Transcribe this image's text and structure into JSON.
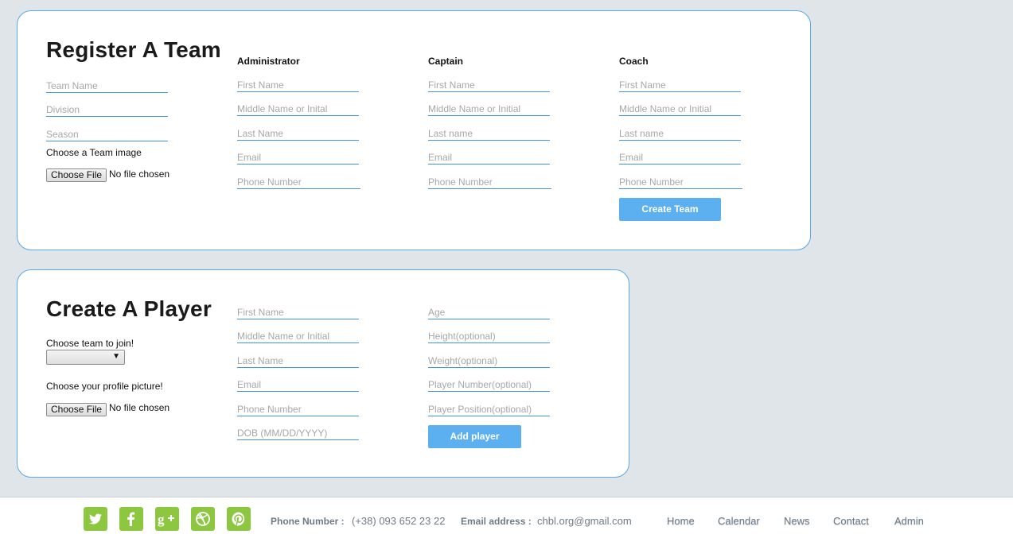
{
  "team_form": {
    "title": "Register A Team",
    "team_name_placeholder": "Team Name",
    "division_placeholder": "Division",
    "season_placeholder": "Season",
    "image_label": "Choose a Team image",
    "file_button": "Choose File",
    "file_status": "No file chosen",
    "administrator": {
      "heading": "Administrator",
      "first_name": "First Name",
      "middle_name": "Middle Name or Inital",
      "last_name": "Last Name",
      "email": "Email",
      "phone": "Phone Number"
    },
    "captain": {
      "heading": "Captain",
      "first_name": "First Name",
      "middle_name": "Middle Name or Initial",
      "last_name": "Last name",
      "email": "Email",
      "phone": "Phone Number"
    },
    "coach": {
      "heading": "Coach",
      "first_name": "First Name",
      "middle_name": "Middle Name or Initial",
      "last_name": "Last name",
      "email": "Email",
      "phone": "Phone Number"
    },
    "submit": "Create Team"
  },
  "player_form": {
    "title": "Create A Player",
    "team_label": "Choose team to join!",
    "team_select_value": "",
    "picture_label": "Choose your profile picture!",
    "file_button": "Choose File",
    "file_status": "No file chosen",
    "first_name": "First Name",
    "middle_name": "Middle Name or Initial",
    "last_name": "Last Name",
    "email": "Email",
    "phone": "Phone Number",
    "dob": "DOB (MM/DD/YYYY)",
    "age": "Age",
    "height": "Height(optional)",
    "weight": "Weight(optional)",
    "player_number": "Player Number(optional)",
    "player_position": "Player Position(optional)",
    "submit": "Add player"
  },
  "footer": {
    "social_icons": [
      "twitter-icon",
      "facebook-icon",
      "google-plus-icon",
      "dribbble-icon",
      "pinterest-icon"
    ],
    "social_color": "#8dc63f",
    "phone_label": "Phone Number :",
    "phone_value": "(+38) 093 652 23 22",
    "email_label": "Email address :",
    "email_value": "chbl.org@gmail.com",
    "nav": [
      "Home",
      "Calendar",
      "News",
      "Contact",
      "Admin"
    ]
  },
  "colors": {
    "accent": "#5cb0f0",
    "card_border": "#5aa8e6",
    "background": "#dfe5e8",
    "footer_text": "#6e7b87"
  }
}
